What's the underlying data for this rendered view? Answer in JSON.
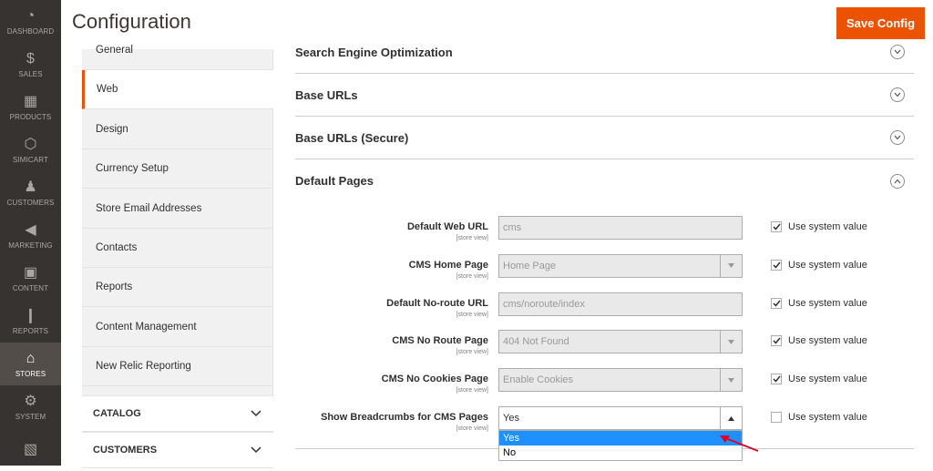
{
  "header": {
    "title": "Configuration",
    "save_label": "Save Config"
  },
  "admin_nav": [
    {
      "icon": "dashboard-icon",
      "glyph": "◔",
      "label": "DASHBOARD"
    },
    {
      "icon": "dollar-icon",
      "glyph": "$",
      "label": "SALES"
    },
    {
      "icon": "cube-icon",
      "glyph": "▦",
      "label": "PRODUCTS"
    },
    {
      "icon": "hexagon-icon",
      "glyph": "⬡",
      "label": "SIMICART"
    },
    {
      "icon": "person-icon",
      "glyph": "♟",
      "label": "CUSTOMERS"
    },
    {
      "icon": "megaphone-icon",
      "glyph": "◀",
      "label": "MARKETING"
    },
    {
      "icon": "content-icon",
      "glyph": "▣",
      "label": "CONTENT"
    },
    {
      "icon": "bar-chart-icon",
      "glyph": "❙",
      "label": "REPORTS"
    },
    {
      "icon": "store-icon",
      "glyph": "⌂",
      "label": "STORES"
    },
    {
      "icon": "gear-icon",
      "glyph": "⚙",
      "label": "SYSTEM"
    },
    {
      "icon": "box-icon",
      "glyph": "▧",
      "label": ""
    }
  ],
  "tabs": {
    "items": [
      "General",
      "Web",
      "Design",
      "Currency Setup",
      "Store Email Addresses",
      "Contacts",
      "Reports",
      "Content Management",
      "New Relic Reporting"
    ],
    "active": "Web",
    "sections": [
      "CATALOG",
      "CUSTOMERS"
    ]
  },
  "fieldsets": {
    "seo": "Search Engine Optimization",
    "base_urls": "Base URLs",
    "base_urls_secure": "Base URLs (Secure)",
    "default_pages": "Default Pages"
  },
  "fields": [
    {
      "label": "Default Web URL",
      "scope": "[store view]",
      "value": "cms",
      "type": "text",
      "use_system": true
    },
    {
      "label": "CMS Home Page",
      "scope": "[store view]",
      "value": "Home Page",
      "type": "select",
      "use_system": true
    },
    {
      "label": "Default No-route URL",
      "scope": "[store view]",
      "value": "cms/noroute/index",
      "type": "text",
      "use_system": true
    },
    {
      "label": "CMS No Route Page",
      "scope": "[store view]",
      "value": "404 Not Found",
      "type": "select",
      "use_system": true
    },
    {
      "label": "CMS No Cookies Page",
      "scope": "[store view]",
      "value": "Enable Cookies",
      "type": "select",
      "use_system": true
    },
    {
      "label": "Show Breadcrumbs for CMS Pages",
      "scope": "[store view]",
      "value": "Yes",
      "type": "select-open",
      "use_system": false
    }
  ],
  "use_system_label": "Use system value",
  "dropdown": {
    "options": [
      "Yes",
      "No"
    ],
    "selected": "Yes"
  },
  "colors": {
    "accent": "#eb5202",
    "nav_bg": "#373330",
    "highlight": "#1e90ff",
    "arrow": "#e0002a"
  }
}
